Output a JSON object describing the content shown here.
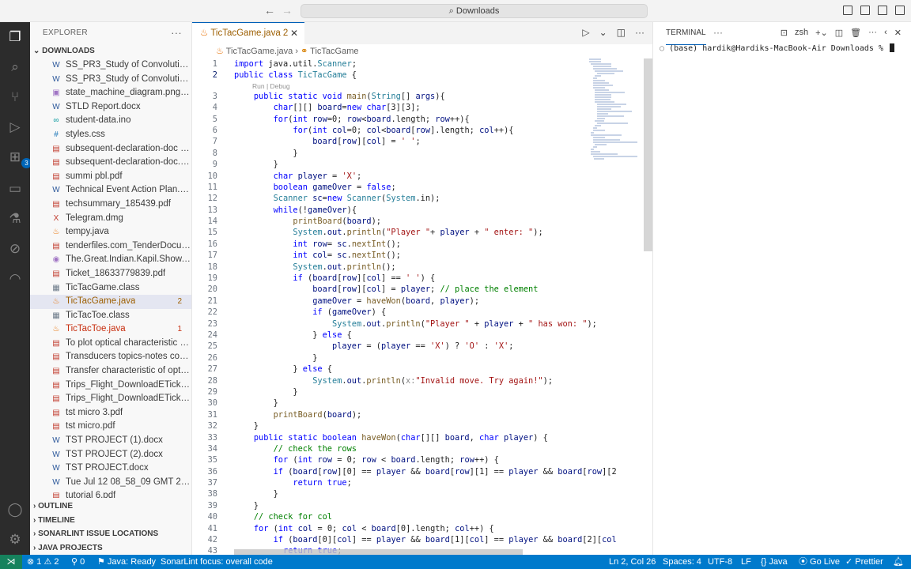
{
  "titlebar": {
    "search": "Downloads",
    "back_icon": "arrow-left-icon",
    "forward_icon": "arrow-right-icon"
  },
  "activity_bar": {
    "extensions_badge": "3"
  },
  "explorer": {
    "title": "EXPLORER",
    "folder": "DOWNLOADS",
    "files": [
      {
        "name": "SS_PR3_Study of Convolution ...",
        "icon": "W",
        "color": "#2b579a"
      },
      {
        "name": "SS_PR3_Study of Convolution ...",
        "icon": "W",
        "color": "#2b579a"
      },
      {
        "name": "state_machine_diagram.png.jpg",
        "icon": "▣",
        "color": "#a074c4"
      },
      {
        "name": "STLD Report.docx",
        "icon": "W",
        "color": "#2b579a"
      },
      {
        "name": "student-data.ino",
        "icon": "∞",
        "color": "#00979c"
      },
      {
        "name": "styles.css",
        "icon": "#",
        "color": "#1572b6"
      },
      {
        "name": "subsequent-declaration-doc (1...",
        "icon": "▤",
        "color": "#c0392b"
      },
      {
        "name": "subsequent-declaration-doc.pdf",
        "icon": "▤",
        "color": "#c0392b"
      },
      {
        "name": "summi pbl.pdf",
        "icon": "▤",
        "color": "#c0392b"
      },
      {
        "name": "Technical Event Action Plan.docx",
        "icon": "W",
        "color": "#2b579a"
      },
      {
        "name": "techsummary_185439.pdf",
        "icon": "▤",
        "color": "#c0392b"
      },
      {
        "name": "Telegram.dmg",
        "icon": "X",
        "color": "#c0392b"
      },
      {
        "name": "tempy.java",
        "icon": "♨",
        "color": "#e76f00"
      },
      {
        "name": "tenderfiles.com_TenderDocum...",
        "icon": "▤",
        "color": "#c0392b"
      },
      {
        "name": "The.Great.Indian.Kapil.Show.S0...",
        "icon": "◉",
        "color": "#a074c4"
      },
      {
        "name": "Ticket_18633779839.pdf",
        "icon": "▤",
        "color": "#c0392b"
      },
      {
        "name": "TicTacGame.class",
        "icon": "▦",
        "color": "#6c7a89"
      },
      {
        "name": "TicTacGame.java",
        "icon": "♨",
        "color": "#e76f00",
        "count": "2",
        "selected": true,
        "name_color": "#9c5e00"
      },
      {
        "name": "TicTacToe.class",
        "icon": "▦",
        "color": "#6c7a89"
      },
      {
        "name": "TicTacToe.java",
        "icon": "♨",
        "color": "#e76f00",
        "count": "1",
        "name_color": "#c72e0f"
      },
      {
        "name": "To plot optical characteristic of...",
        "icon": "▤",
        "color": "#c0392b"
      },
      {
        "name": "Transducers topics-notes cove...",
        "icon": "▤",
        "color": "#c0392b"
      },
      {
        "name": "Transfer characteristic of opto...",
        "icon": "▤",
        "color": "#c0392b"
      },
      {
        "name": "Trips_Flight_DownloadETicket ...",
        "icon": "▤",
        "color": "#c0392b"
      },
      {
        "name": "Trips_Flight_DownloadETicket....",
        "icon": "▤",
        "color": "#c0392b"
      },
      {
        "name": "tst micro 3.pdf",
        "icon": "▤",
        "color": "#c0392b"
      },
      {
        "name": "tst micro.pdf",
        "icon": "▤",
        "color": "#c0392b"
      },
      {
        "name": "TST PROJECT (1).docx",
        "icon": "W",
        "color": "#2b579a"
      },
      {
        "name": "TST PROJECT (2).docx",
        "icon": "W",
        "color": "#2b579a"
      },
      {
        "name": "TST PROJECT.docx",
        "icon": "W",
        "color": "#2b579a"
      },
      {
        "name": "Tue Jul 12 08_58_09 GMT 202...",
        "icon": "W",
        "color": "#2b579a"
      },
      {
        "name": "tutorial 6.pdf",
        "icon": "▤",
        "color": "#c0392b"
      }
    ],
    "sections": [
      "OUTLINE",
      "TIMELINE",
      "SONARLINT ISSUE LOCATIONS",
      "JAVA PROJECTS"
    ]
  },
  "editor": {
    "tab_label": "TicTacGame.java",
    "tab_count": "2",
    "breadcrumb_file": "TicTacGame.java",
    "breadcrumb_symbol": "TicTacGame",
    "codelens": "Run | Debug",
    "lines": [
      "<span class=\"k\">import</span> java.util.<span class=\"t\">Scanner</span>;",
      "<span class=\"k\">public class</span> <span class=\"t\">TicTacGame</span> {",
      "    <span class=\"k\">public static void</span> <span class=\"f\">main</span>(<span class=\"t\">String</span>[] <span class=\"v\">args</span>){",
      "        <span class=\"k\">char</span>[][] <span class=\"v\">board</span>=<span class=\"k\">new char</span>[3][3];",
      "        <span class=\"k\">for</span>(<span class=\"k\">int</span> <span class=\"v\">row</span>=0; <span class=\"v\">row</span>&lt;<span class=\"v\">board</span>.length; <span class=\"v\">row</span>++){",
      "            <span class=\"k\">for</span>(<span class=\"k\">int</span> <span class=\"v\">col</span>=0; <span class=\"v\">col</span>&lt;<span class=\"v\">board</span>[<span class=\"v\">row</span>].length; <span class=\"v\">col</span>++){",
      "                <span class=\"v\">board</span>[<span class=\"v\">row</span>][<span class=\"v\">col</span>] = <span class=\"s\">' '</span>;",
      "            }",
      "        }",
      "        <span class=\"k\">char</span> <span class=\"v\">player</span> = <span class=\"s\">'X'</span>;",
      "        <span class=\"k\">boolean</span> <span class=\"v\">gameOver</span> = <span class=\"k\">false</span>;",
      "        <span class=\"t\">Scanner</span> <span class=\"v\">sc</span>=<span class=\"k\">new</span> <span class=\"t\">Scanner</span>(<span class=\"t\">System</span>.in);",
      "        <span class=\"k\">while</span>(!<span class=\"v\">gameOver</span>){",
      "            <span class=\"f\">printBoard</span>(<span class=\"v\">board</span>);",
      "            <span class=\"t\">System</span>.<span class=\"v\">out</span>.<span class=\"f\">println</span>(<span class=\"s\">\"Player \"</span>+ <span class=\"v\">player</span> + <span class=\"s\">\" enter: \"</span>);",
      "            <span class=\"k\">int</span> <span class=\"v\">row</span>= <span class=\"v\">sc</span>.<span class=\"f\">nextInt</span>();",
      "            <span class=\"k\">int</span> <span class=\"v\">col</span>= <span class=\"v\">sc</span>.<span class=\"f\">nextInt</span>();",
      "            <span class=\"t\">System</span>.<span class=\"v\">out</span>.<span class=\"f\">println</span>();",
      "            <span class=\"k\">if</span> (<span class=\"v\">board</span>[<span class=\"v\">row</span>][<span class=\"v\">col</span>] == <span class=\"s\">' '</span>) {",
      "                <span class=\"v\">board</span>[<span class=\"v\">row</span>][<span class=\"v\">col</span>] = <span class=\"v\">player</span>; <span class=\"c\">// place the element</span>",
      "                <span class=\"v\">gameOver</span> = <span class=\"f\">haveWon</span>(<span class=\"v\">board</span>, <span class=\"v\">player</span>);",
      "                <span class=\"k\">if</span> (<span class=\"v\">gameOver</span>) {",
      "                    <span class=\"t\">System</span>.<span class=\"v\">out</span>.<span class=\"f\">println</span>(<span class=\"s\">\"Player \"</span> + <span class=\"v\">player</span> + <span class=\"s\">\" has won: \"</span>);",
      "                } <span class=\"k\">else</span> {",
      "                    <span class=\"v\">player</span> = (<span class=\"v\">player</span> == <span class=\"s\">'X'</span>) ? <span class=\"s\">'O'</span> : <span class=\"s\">'X'</span>;",
      "                }",
      "            } <span class=\"k\">else</span> {",
      "                <span class=\"t\">System</span>.<span class=\"v\">out</span>.<span class=\"f\">println</span>(<span style=\"color:#8a8a8a\">x:</span><span class=\"s\">\"Invalid move. Try again!\"</span>);",
      "            }",
      "        }",
      "        <span class=\"f\">printBoard</span>(<span class=\"v\">board</span>);",
      "    }",
      "    <span class=\"k\">public static boolean</span> <span class=\"f\">haveWon</span>(<span class=\"k\">char</span>[][] <span class=\"v\">board</span>, <span class=\"k\">char</span> <span class=\"v\">player</span>) {",
      "        <span class=\"c\">// check the rows</span>",
      "        <span class=\"k\">for</span> (<span class=\"k\">int</span> <span class=\"v\">row</span> = 0; <span class=\"v\">row</span> &lt; <span class=\"v\">board</span>.length; <span class=\"v\">row</span>++) {",
      "        <span class=\"k\">if</span> (<span class=\"v\">board</span>[<span class=\"v\">row</span>][0] == <span class=\"v\">player</span> &amp;&amp; <span class=\"v\">board</span>[<span class=\"v\">row</span>][1] == <span class=\"v\">player</span> &amp;&amp; <span class=\"v\">board</span>[<span class=\"v\">row</span>][2",
      "            <span class=\"k\">return true</span>;",
      "        }",
      "    }",
      "    <span class=\"c\">// check for col</span>",
      "    <span class=\"k\">for</span> (<span class=\"k\">int</span> <span class=\"v\">col</span> = 0; <span class=\"v\">col</span> &lt; <span class=\"v\">board</span>[0].length; <span class=\"v\">col</span>++) {",
      "        <span class=\"k\">if</span> (<span class=\"v\">board</span>[0][<span class=\"v\">col</span>] == <span class=\"v\">player</span> &amp;&amp; <span class=\"v\">board</span>[1][<span class=\"v\">col</span>] == <span class=\"v\">player</span> &amp;&amp; <span class=\"v\">board</span>[2][<span class=\"v\">col</span>",
      "          <span class=\"k\">return true</span>;"
    ]
  },
  "terminal": {
    "tab_label": "TERMINAL",
    "shell": "zsh",
    "prompt": "(base) hardik@Hardiks-MacBook-Air Downloads % "
  },
  "statusbar": {
    "problems": "⊗ 1 ⚠ 2",
    "ports": "⚲ 0",
    "java": "⚑ Java: Ready",
    "sonar": "SonarLint focus: overall code",
    "position": "Ln 2, Col 26",
    "spaces": "Spaces: 4",
    "encoding": "UTF-8",
    "eol": "LF",
    "language": "{} Java",
    "golive": "⦿ Go Live",
    "prettier": "✓ Prettier",
    "bell": "🔔︎"
  }
}
